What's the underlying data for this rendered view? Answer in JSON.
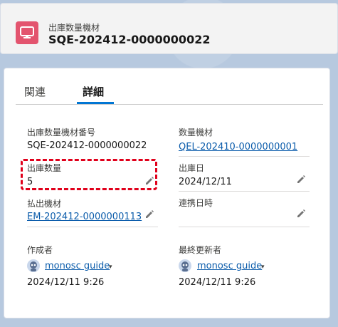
{
  "header": {
    "object_label": "出庫数量機材",
    "record_name": "SQE-202412-0000000022"
  },
  "tabs": [
    {
      "label": "関連"
    },
    {
      "label": "詳細"
    }
  ],
  "fields": {
    "record_number": {
      "label": "出庫数量機材番号",
      "value": "SQE-202412-0000000022"
    },
    "quantity_equipment": {
      "label": "数量機材",
      "value": "QEL-202410-0000000001"
    },
    "shipping_quantity": {
      "label": "出庫数量",
      "value": "5"
    },
    "shipping_date": {
      "label": "出庫日",
      "value": "2024/12/11"
    },
    "dispatch_equipment": {
      "label": "払出機材",
      "value": "EM-202412-0000000113"
    },
    "sync_datetime": {
      "label": "連携日時",
      "value": ""
    },
    "created_by": {
      "label": "作成者",
      "user": "monosc guide",
      "datetime": "2024/12/11 9:26"
    },
    "last_modified_by": {
      "label": "最終更新者",
      "user": "monosc guide",
      "datetime": "2024/12/11 9:26"
    }
  },
  "colors": {
    "accent": "#0176d3",
    "link": "#0b5cab",
    "object_icon": "#e3546e",
    "highlight": "#e0001b"
  },
  "icons": {
    "object": "monitor-icon",
    "edit": "pencil-icon",
    "avatar": "user-avatar-icon"
  }
}
